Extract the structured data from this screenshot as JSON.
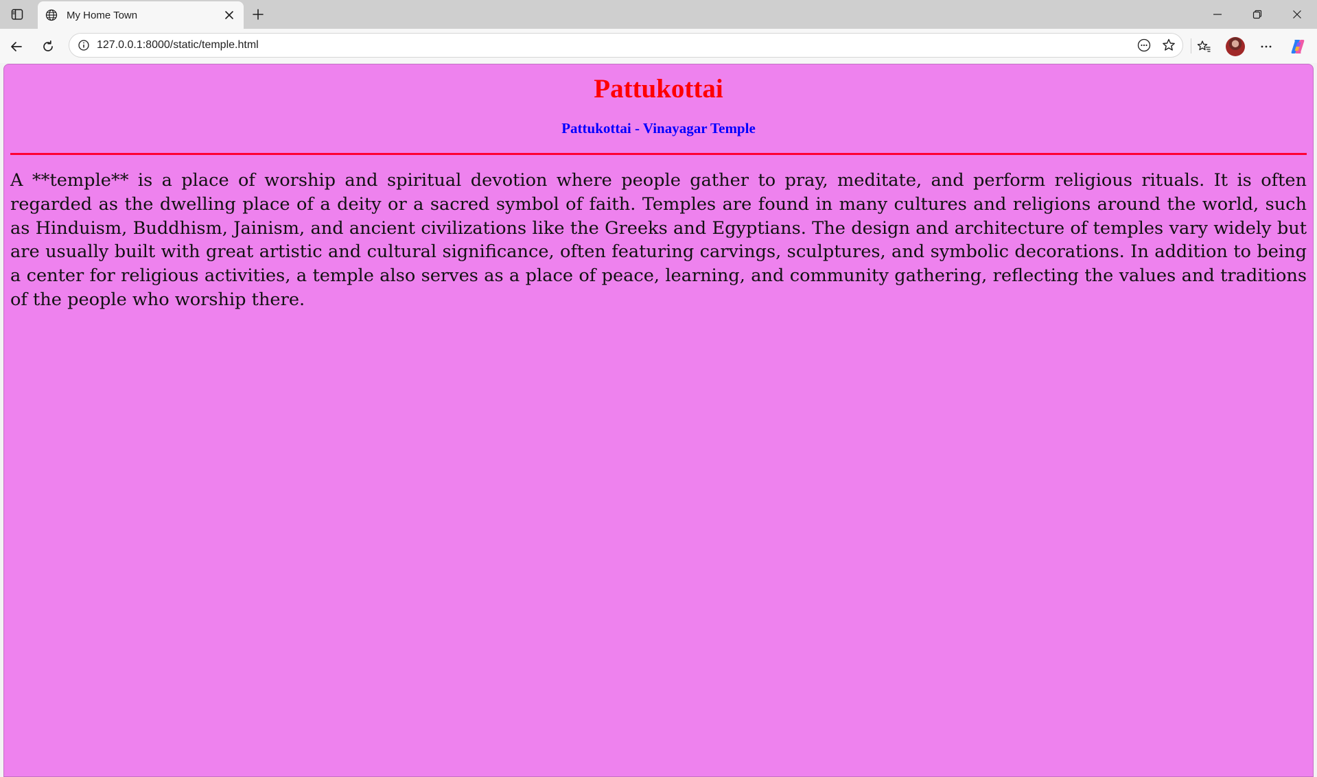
{
  "browser": {
    "tab": {
      "title": "My Home Town"
    },
    "address_bar": {
      "url": "127.0.0.1:8000/static/temple.html"
    }
  },
  "page": {
    "background_color": "#ee82ee",
    "title": "Pattukottai",
    "title_color": "#ff0000",
    "subtitle": "Pattukottai - Vinayagar Temple",
    "subtitle_color": "#0000ff",
    "rule_color": "#ff0033",
    "body_text": "A **temple** is a place of worship and spiritual devotion where people gather to pray, meditate, and perform religious rituals. It is often regarded as the dwelling place of a deity or a sacred symbol of faith. Temples are found in many cultures and religions around the world, such as Hinduism, Buddhism, Jainism, and ancient civilizations like the Greeks and Egyptians. The design and architecture of temples vary widely but are usually built with great artistic and cultural significance, often featuring carvings, sculptures, and symbolic decorations. In addition to being a center for religious activities, a temple also serves as a place of peace, learning, and community gathering, reflecting the values and traditions of the people who worship there."
  }
}
